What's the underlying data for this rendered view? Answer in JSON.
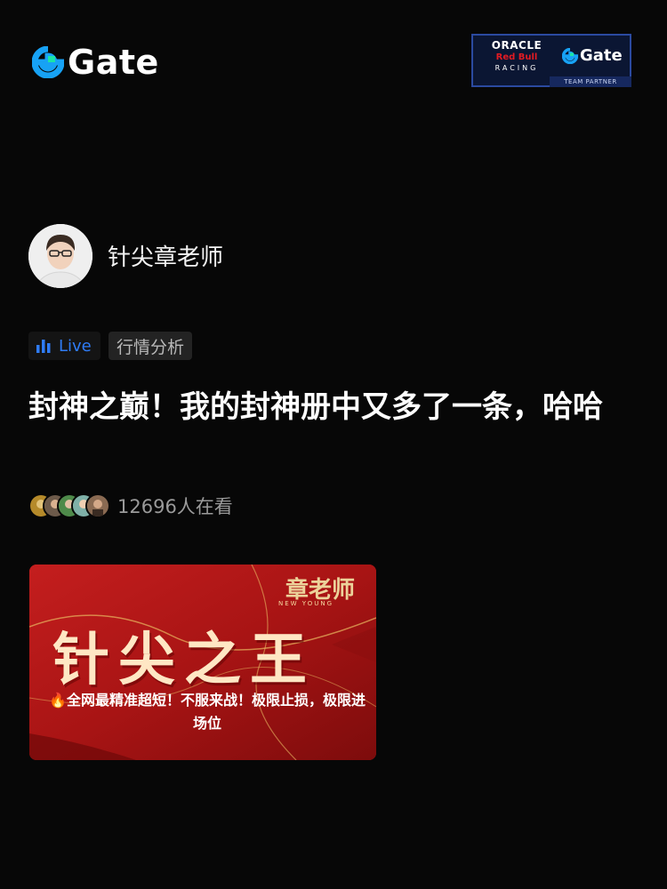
{
  "brand": {
    "name": "Gate",
    "color": "#17a2f5"
  },
  "partner": {
    "oracle": "ORACLE",
    "redbull": "Red Bull",
    "racing": "RACING",
    "gate": "Gate",
    "tagline": "TEAM PARTNER"
  },
  "author": {
    "name": "针尖章老师",
    "avatar_icon": "person-avatar"
  },
  "tags": {
    "live": "Live",
    "category": "行情分析"
  },
  "post": {
    "title": "封神之巅！我的封神册中又多了一条，哈哈"
  },
  "viewers": {
    "count_text": "12696人在看"
  },
  "cover": {
    "brand": "章老师",
    "brand_sub": "NEW YOUNG",
    "headline": "针尖之王",
    "caption": "🔥全网最精准超短！不服来战！极限止损，极限进场位"
  },
  "colors": {
    "accent_blue": "#2f7cf6",
    "background": "#070707",
    "cover_red": "#b01818",
    "gold": "#ecd29a"
  }
}
